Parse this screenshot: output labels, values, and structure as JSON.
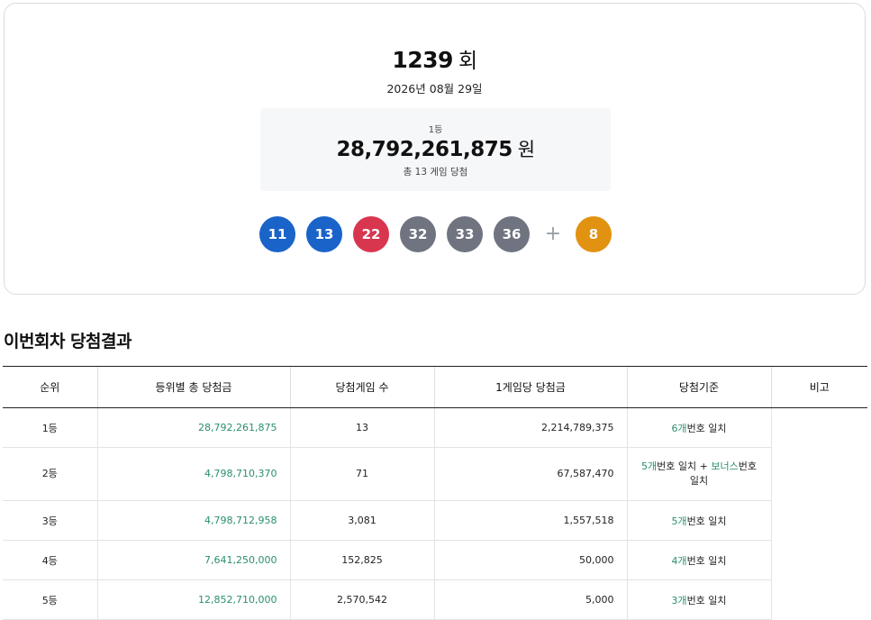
{
  "draw": {
    "number": "1239",
    "unit": "회",
    "date": "2026년 08월 29일"
  },
  "first_prize": {
    "rank_label": "1등",
    "amount": "28,792,261,875",
    "currency": "원",
    "games_text": "총 13 게임 당첨"
  },
  "balls": [
    {
      "number": "11",
      "color": "#1a63c9"
    },
    {
      "number": "13",
      "color": "#1a63c9"
    },
    {
      "number": "22",
      "color": "#d8364f"
    },
    {
      "number": "32",
      "color": "#6f7480"
    },
    {
      "number": "33",
      "color": "#6f7480"
    },
    {
      "number": "36",
      "color": "#6f7480"
    }
  ],
  "plus_symbol": "+",
  "bonus_ball": {
    "number": "8",
    "color": "#e29211"
  },
  "section_title": "이번회차 당첨결과",
  "table": {
    "headers": [
      "순위",
      "등위별 총 당첨금",
      "당첨게임 수",
      "1게임당 당첨금",
      "당첨기준",
      "비고"
    ],
    "rows": [
      {
        "rank": "1등",
        "total": "28,792,261,875",
        "games": "13",
        "per_game": "2,214,789,375",
        "criteria_count": "6개",
        "criteria_text": "번호 일치"
      },
      {
        "rank": "2등",
        "total": "4,798,710,370",
        "games": "71",
        "per_game": "67,587,470",
        "criteria_count": "5개",
        "criteria_text": "번호 일치 + ",
        "criteria_bonus": "보너스",
        "criteria_text2": "번호 일치"
      },
      {
        "rank": "3등",
        "total": "4,798,712,958",
        "games": "3,081",
        "per_game": "1,557,518",
        "criteria_count": "5개",
        "criteria_text": "번호 일치"
      },
      {
        "rank": "4등",
        "total": "7,641,250,000",
        "games": "152,825",
        "per_game": "50,000",
        "criteria_count": "4개",
        "criteria_text": "번호 일치"
      },
      {
        "rank": "5등",
        "total": "12,852,710,000",
        "games": "2,570,542",
        "per_game": "5,000",
        "criteria_count": "3개",
        "criteria_text": "번호 일치"
      }
    ]
  }
}
